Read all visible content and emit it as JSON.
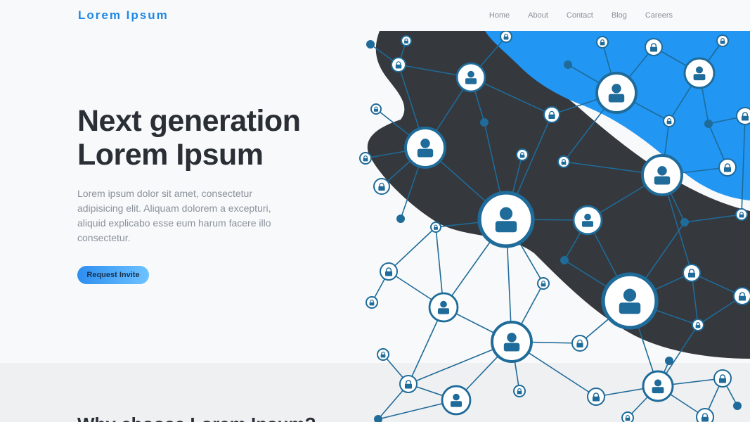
{
  "brand": "Lorem Ipsum",
  "nav": {
    "items": [
      "Home",
      "About",
      "Contact",
      "Blog",
      "Careers"
    ]
  },
  "hero": {
    "title_line1": "Next generation",
    "title_line2": "Lorem Ipsum",
    "description": "Lorem ipsum dolor sit amet, consectetur adipisicing elit. Aliquam dolorem a excepturi, aliquid explicabo esse eum harum facere illo consectetur.",
    "cta_label": "Request Invite"
  },
  "section": {
    "heading": "Why choose Lorem Ipsum?"
  },
  "illustration": {
    "icon": "people-network-illustration",
    "colors": {
      "dark_blob": "#35383c",
      "blue_blob": "#2196f3",
      "network": "#1f6b99"
    }
  }
}
